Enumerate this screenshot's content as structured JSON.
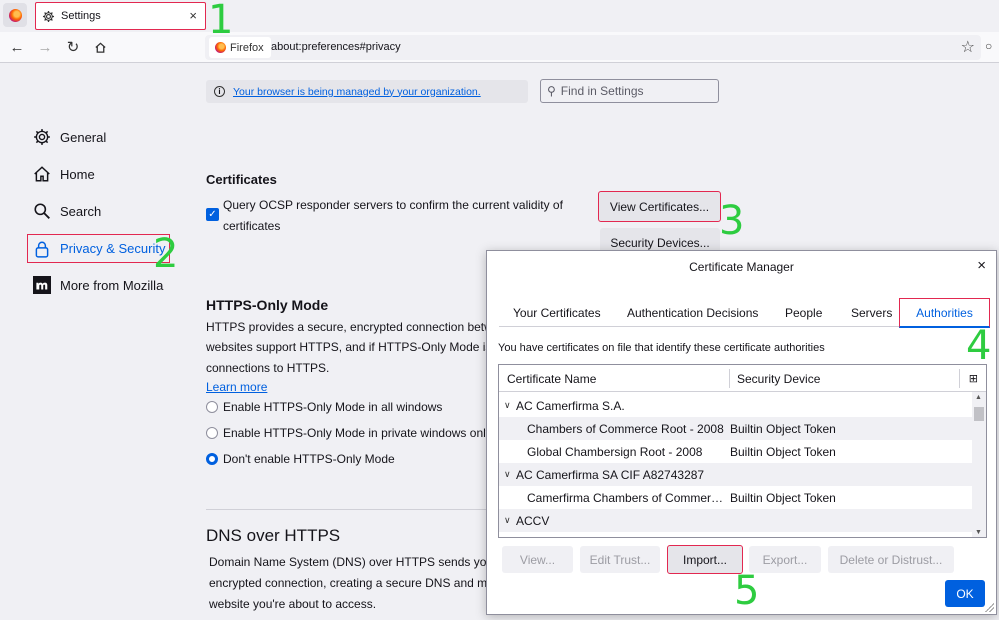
{
  "tab": {
    "title": "Settings",
    "close": "×"
  },
  "urlbar": {
    "identity": "Firefox",
    "url": "about:preferences#privacy"
  },
  "managed_notice": "Your browser is being managed by your organization.",
  "find": {
    "placeholder": "Find in Settings"
  },
  "sidebar": {
    "items": [
      {
        "label": "General"
      },
      {
        "label": "Home"
      },
      {
        "label": "Search"
      },
      {
        "label": "Privacy & Security"
      },
      {
        "label": "More from Mozilla"
      }
    ]
  },
  "certificates": {
    "heading": "Certificates",
    "ocsp_line1": "Query OCSP responder servers to confirm the current validity of",
    "ocsp_line2": "certificates",
    "view_button": "View Certificates...",
    "devices_button": "Security Devices..."
  },
  "https_only": {
    "heading": "HTTPS-Only Mode",
    "desc_line1": "HTTPS provides a secure, encrypted connection betwee",
    "desc_line2": "websites support HTTPS, and if HTTPS-Only Mode is en",
    "desc_line3": "connections to HTTPS.",
    "learn_more": "Learn more",
    "options": [
      "Enable HTTPS-Only Mode in all windows",
      "Enable HTTPS-Only Mode in private windows only",
      "Don't enable HTTPS-Only Mode"
    ],
    "selected_index": 2
  },
  "dns": {
    "heading": "DNS over HTTPS",
    "line1": "Domain Name System (DNS) over HTTPS sends your re",
    "line2": "encrypted connection, creating a secure DNS and maki",
    "line3": "website you're about to access."
  },
  "annotations": [
    "1",
    "2",
    "3",
    "4",
    "5"
  ],
  "dialog": {
    "title": "Certificate Manager",
    "close": "×",
    "tabs": [
      "Your Certificates",
      "Authentication Decisions",
      "People",
      "Servers",
      "Authorities"
    ],
    "selected_tab": "Authorities",
    "description": "You have certificates on file that identify these certificate authorities",
    "columns": [
      "Certificate Name",
      "Security Device"
    ],
    "rows": [
      {
        "type": "group",
        "name": "AC Camerfirma S.A."
      },
      {
        "type": "cert",
        "name": "Chambers of Commerce Root - 2008",
        "device": "Builtin Object Token"
      },
      {
        "type": "cert",
        "name": "Global Chambersign Root - 2008",
        "device": "Builtin Object Token"
      },
      {
        "type": "group",
        "name": "AC Camerfirma SA CIF A82743287"
      },
      {
        "type": "cert",
        "name": "Camerfirma Chambers of Commerce Root",
        "device": "Builtin Object Token"
      },
      {
        "type": "group",
        "name": "ACCV"
      }
    ],
    "buttons": [
      "View...",
      "Edit Trust...",
      "Import...",
      "Export...",
      "Delete or Distrust..."
    ],
    "ok": "OK"
  }
}
